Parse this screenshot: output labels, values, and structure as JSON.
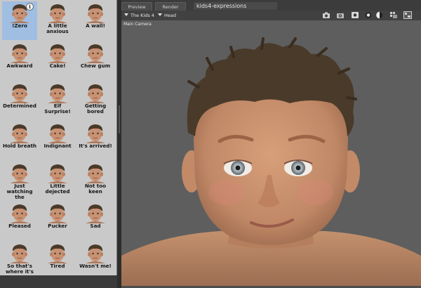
{
  "library": {
    "items": [
      {
        "label": "!Zero",
        "selected": true
      },
      {
        "label": "A little\nanxious"
      },
      {
        "label": "A wall!"
      },
      {
        "label": "Awkward"
      },
      {
        "label": "Cake!"
      },
      {
        "label": "Chew gum"
      },
      {
        "label": "Determined"
      },
      {
        "label": "Elf Surprise!"
      },
      {
        "label": "Getting\nbored"
      },
      {
        "label": "Hold breath"
      },
      {
        "label": "Indignant"
      },
      {
        "label": "It's arrived!"
      },
      {
        "label": "Just\nwatching the"
      },
      {
        "label": "Little\ndejected"
      },
      {
        "label": "Not too keen"
      },
      {
        "label": "Pleased"
      },
      {
        "label": "Pucker"
      },
      {
        "label": "Sad"
      },
      {
        "label": "So that's\nwhere it's"
      },
      {
        "label": "Tired"
      },
      {
        "label": "Wasn't me!"
      }
    ],
    "info_badge": "i"
  },
  "viewport": {
    "tabs": {
      "preview": "Preview",
      "render": "Render"
    },
    "title": "kids4-expressions",
    "scene_dropdown": "The Kids 4",
    "node_dropdown": "Head",
    "camera_label": "Main Camera",
    "toolbar_icons": [
      "camera-icon",
      "camera-alt-icon",
      "record-icon",
      "sphere-icon",
      "contrast-icon",
      "grid-icon",
      "layout-icon"
    ]
  },
  "colors": {
    "library_bg": "#c9c9c9",
    "selected_bg": "#9fbee2",
    "viewport_bg": "#5e5e5e",
    "hair": "#4a3a2a",
    "skin": "#c9906b"
  }
}
